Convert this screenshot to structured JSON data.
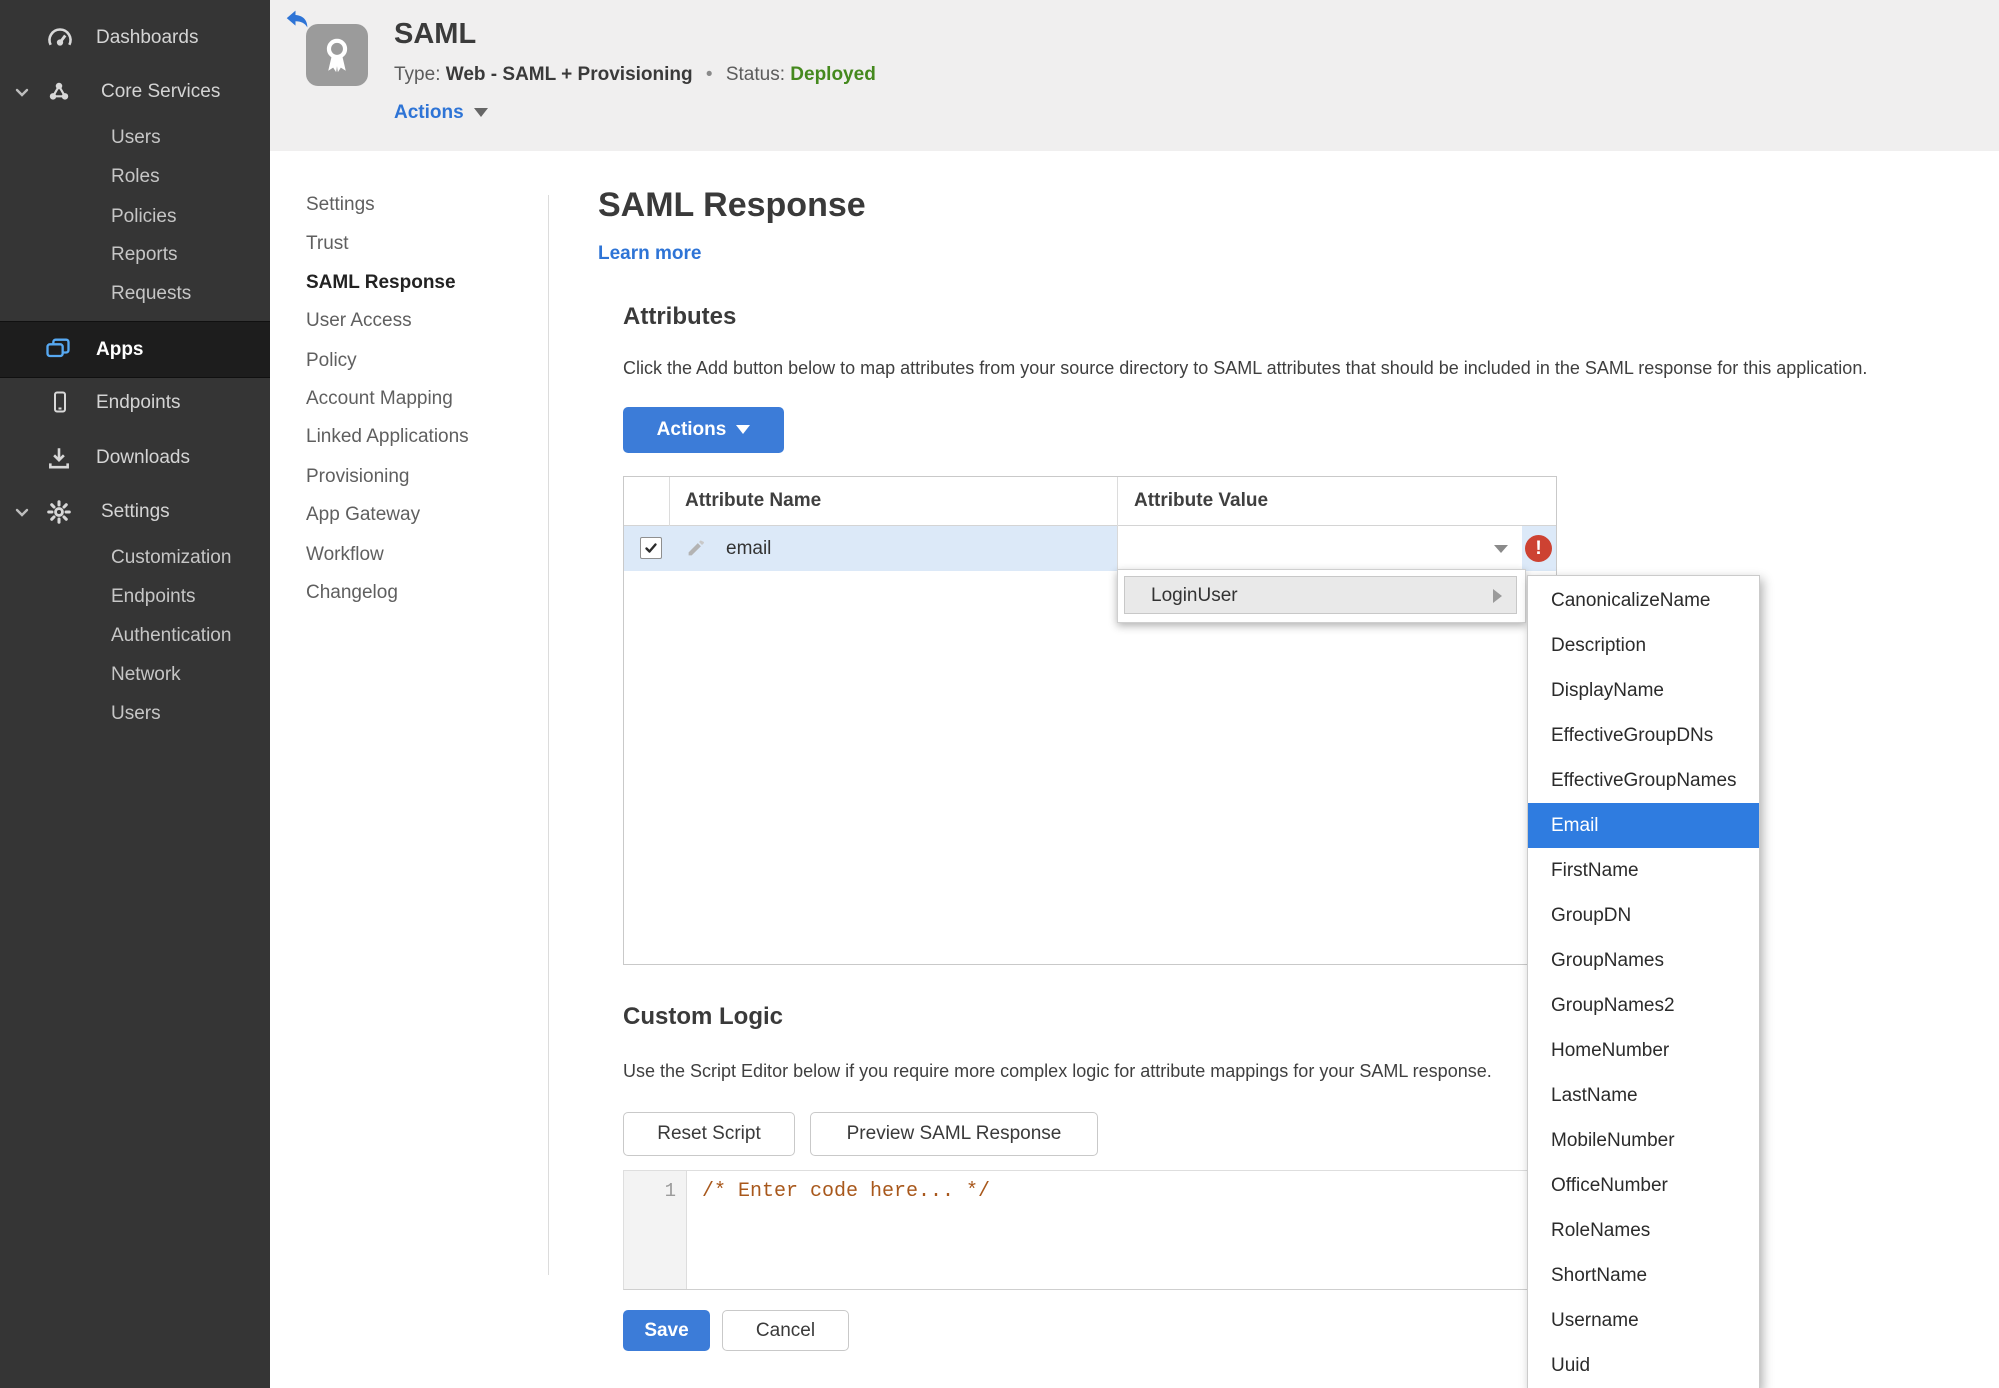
{
  "colors": {
    "accent_blue": "#2e74d6",
    "button_blue": "#3c7cd8",
    "selection_blue": "#2f7ce0",
    "status_green": "#45891e",
    "error_red": "#cd4232",
    "row_highlight": "#dce9f8",
    "sidebar_bg": "#353535",
    "header_bg": "#f0efef",
    "code_orange": "#a8581c"
  },
  "icons": {
    "back": "reply-arrow",
    "app_badge": "award-ribbon",
    "dashboards": "gauge",
    "core_services": "cluster",
    "apps": "stacked-windows",
    "endpoints": "smartphone",
    "downloads": "download-tray",
    "settings": "gear",
    "expand": "chevron-down",
    "edit": "pencil",
    "dropdown": "caret-down",
    "submenu": "caret-right",
    "error": "exclamation-circle",
    "checked": "checkmark"
  },
  "sidebar": {
    "items": [
      {
        "label": "Dashboards"
      },
      {
        "label": "Core Services"
      },
      {
        "label": "Users"
      },
      {
        "label": "Roles"
      },
      {
        "label": "Policies"
      },
      {
        "label": "Reports"
      },
      {
        "label": "Requests"
      },
      {
        "label": "Apps"
      },
      {
        "label": "Endpoints"
      },
      {
        "label": "Downloads"
      },
      {
        "label": "Settings"
      },
      {
        "label": "Customization"
      },
      {
        "label": "Endpoints"
      },
      {
        "label": "Authentication"
      },
      {
        "label": "Network"
      },
      {
        "label": "Users"
      }
    ]
  },
  "header": {
    "app_title": "SAML",
    "type_label": "Type:",
    "type_value": "Web - SAML + Provisioning",
    "separator": "•",
    "status_label": "Status:",
    "status_value": "Deployed",
    "actions_label": "Actions"
  },
  "subnav": {
    "items": [
      {
        "label": "Settings"
      },
      {
        "label": "Trust"
      },
      {
        "label": "SAML Response"
      },
      {
        "label": "User Access"
      },
      {
        "label": "Policy"
      },
      {
        "label": "Account Mapping"
      },
      {
        "label": "Linked Applications"
      },
      {
        "label": "Provisioning"
      },
      {
        "label": "App Gateway"
      },
      {
        "label": "Workflow"
      },
      {
        "label": "Changelog"
      }
    ]
  },
  "main": {
    "title": "SAML Response",
    "learn_more": "Learn more",
    "attributes": {
      "heading": "Attributes",
      "description": "Click the Add button below to map attributes from your source directory to SAML attributes that should be included in the SAML response for this application.",
      "actions_button": "Actions",
      "table": {
        "columns": [
          "Attribute Name",
          "Attribute Value"
        ],
        "rows": [
          {
            "name": "email",
            "value": "",
            "checked": "true"
          }
        ]
      },
      "error_mark": "!"
    },
    "dropdown": {
      "parent_item": "LoginUser",
      "selected": "Email",
      "submenu": [
        "CanonicalizeName",
        "Description",
        "DisplayName",
        "EffectiveGroupDNs",
        "EffectiveGroupNames",
        "Email",
        "FirstName",
        "GroupDN",
        "GroupNames",
        "GroupNames2",
        "HomeNumber",
        "LastName",
        "MobileNumber",
        "OfficeNumber",
        "RoleNames",
        "ShortName",
        "Username",
        "Uuid"
      ]
    },
    "custom_logic": {
      "heading": "Custom Logic",
      "description": "Use the Script Editor below if you require more complex logic for attribute mappings for your SAML response.",
      "reset_button": "Reset Script",
      "preview_button": "Preview SAML Response",
      "editor": {
        "line_number": "1",
        "code": "/* Enter code here... */"
      }
    },
    "footer": {
      "save": "Save",
      "cancel": "Cancel"
    }
  }
}
